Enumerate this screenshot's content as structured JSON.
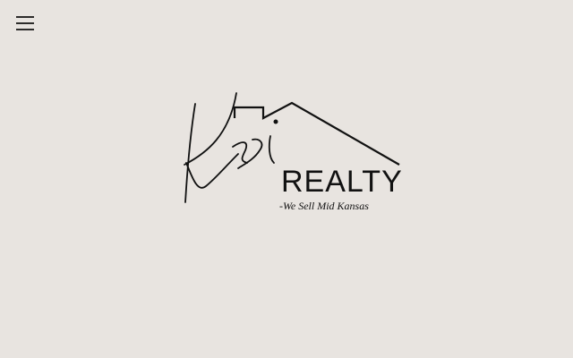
{
  "header": {
    "menu_icon": "hamburger-menu-icon"
  },
  "logo": {
    "script_text": "Ksi",
    "wordmark": "REALTY",
    "tagline": "-We Sell Mid Kansas",
    "ink_color": "#111111"
  },
  "colors": {
    "background": "#e8e4e0"
  }
}
